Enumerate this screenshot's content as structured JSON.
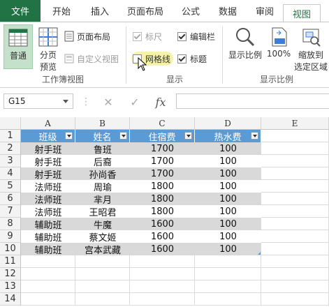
{
  "ribbon": {
    "tabs": [
      "文件",
      "开始",
      "插入",
      "页面布局",
      "公式",
      "数据",
      "审阅",
      "视图"
    ],
    "active_tab": "视图",
    "workbook_views": {
      "normal": "普通",
      "page_break_line1": "分页",
      "page_break_line2": "预览",
      "page_layout": "页面布局",
      "custom_views": "自定义视图",
      "group_label": "工作簿视图"
    },
    "show": {
      "ruler": "标尺",
      "formula_bar": "编辑栏",
      "gridlines": "网格线",
      "headings": "标题",
      "group_label": "显示"
    },
    "zoom": {
      "zoom": "显示比例",
      "hundred": "100%",
      "zoom_selection_line1": "缩放到",
      "zoom_selection_line2": "选定区域",
      "group_label": "显示比例"
    }
  },
  "formula_bar": {
    "name_box": "G15",
    "fx": "fx"
  },
  "sheet": {
    "columns": [
      "A",
      "B",
      "C",
      "D",
      "E"
    ],
    "row_numbers": [
      "1",
      "2",
      "3",
      "4",
      "5",
      "6",
      "7",
      "8",
      "9",
      "10",
      "11",
      "12",
      "13",
      "14"
    ],
    "headers": [
      "班级",
      "姓名",
      "住宿费",
      "热水费"
    ],
    "rows": [
      [
        "射手班",
        "鲁班",
        "1700",
        "100"
      ],
      [
        "射手班",
        "后裔",
        "1700",
        "100"
      ],
      [
        "射手班",
        "孙尚香",
        "1700",
        "100"
      ],
      [
        "法师班",
        "周瑜",
        "1800",
        "100"
      ],
      [
        "法师班",
        "芈月",
        "1800",
        "100"
      ],
      [
        "法师班",
        "王昭君",
        "1800",
        "100"
      ],
      [
        "辅助班",
        "牛魔",
        "1600",
        "100"
      ],
      [
        "辅助班",
        "蔡文姬",
        "1600",
        "100"
      ],
      [
        "辅助班",
        "宫本武藏",
        "1600",
        "100"
      ]
    ]
  },
  "colors": {
    "brand": "#217346",
    "table_header": "#5b9bd5",
    "band": "#d9d9d9"
  }
}
